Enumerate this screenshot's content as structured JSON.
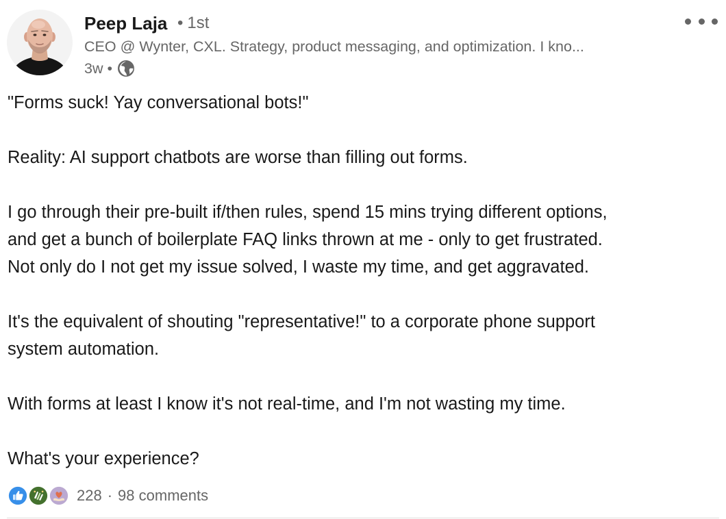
{
  "author": {
    "name": "Peep Laja",
    "degree": "1st",
    "degree_separator": "•",
    "headline": "CEO @ Wynter, CXL. Strategy, product messaging, and optimization. I kno...",
    "avatar_icon": "profile-photo"
  },
  "meta": {
    "time_ago": "3w",
    "separator": "•",
    "visibility_icon": "globe-icon"
  },
  "more_icon": "ellipsis-icon",
  "body": {
    "paragraphs": [
      [
        "\"Forms suck! Yay conversational bots!\""
      ],
      [
        "Reality: AI support chatbots are worse than filling out forms."
      ],
      [
        "I go through their pre-built if/then rules, spend 15 mins trying different options,",
        "and get a bunch of boilerplate FAQ links thrown at me - only to get frustrated.",
        "Not only do I not get my issue solved, I waste my time, and get aggravated."
      ],
      [
        "It's the equivalent of shouting \"representative!\" to a corporate phone support",
        "system automation."
      ],
      [
        "With forms at least I know it's not real-time, and I'm not wasting my time."
      ],
      [
        "What's your experience?"
      ]
    ]
  },
  "social": {
    "reactions": [
      "like-icon",
      "celebrate-icon",
      "love-icon"
    ],
    "reaction_count": "228",
    "separator": "·",
    "comments": "98 comments"
  },
  "colors": {
    "text_primary": "#191919",
    "text_secondary": "#666666",
    "like_blue": "#378fe9",
    "celebrate_green": "#44712e",
    "love_pink": "#df704d"
  }
}
